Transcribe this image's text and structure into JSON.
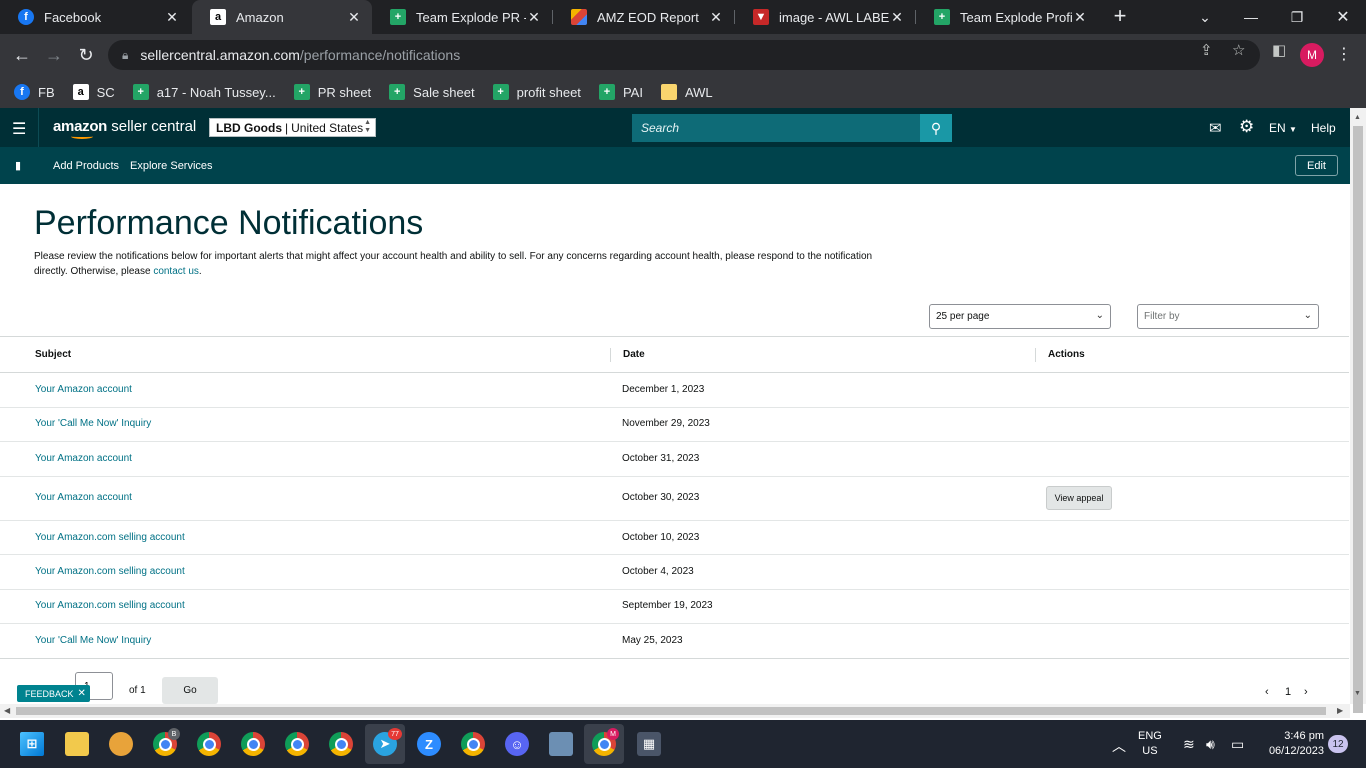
{
  "browser": {
    "tabs": [
      {
        "title": "Facebook",
        "icon": "facebook-icon"
      },
      {
        "title": "Amazon",
        "icon": "amazon-icon",
        "active": true
      },
      {
        "title": "Team Explode PR - Go",
        "icon": "sheets-icon"
      },
      {
        "title": "AMZ EOD Report",
        "icon": "eod-report-icon"
      },
      {
        "title": "image - AWL LABEL",
        "icon": "awl-icon"
      },
      {
        "title": "Team Explode Profit S",
        "icon": "sheets-icon"
      }
    ],
    "url_host": "sellercentral.amazon.com",
    "url_path": "/performance/notifications",
    "profile_initial": "M",
    "bookmarks": [
      {
        "label": "FB",
        "icon": "facebook-icon"
      },
      {
        "label": "SC",
        "icon": "amazon-icon"
      },
      {
        "label": "a17 - Noah Tussey...",
        "icon": "sheets-icon"
      },
      {
        "label": "PR sheet",
        "icon": "sheets-icon"
      },
      {
        "label": "Sale sheet",
        "icon": "sheets-icon"
      },
      {
        "label": "profit sheet",
        "icon": "sheets-icon"
      },
      {
        "label": "PAI",
        "icon": "sheets-icon"
      },
      {
        "label": "AWL",
        "icon": "folder-icon"
      }
    ]
  },
  "header": {
    "logo_brand": "amazon",
    "logo_suffix": " seller central",
    "store_name": "LBD Goods",
    "store_region": "United States",
    "search_placeholder": "Search",
    "language": "EN",
    "help": "Help",
    "nav_links": [
      "Add Products",
      "Explore Services"
    ],
    "edit": "Edit"
  },
  "page": {
    "title": "Performance Notifications",
    "intro": "Please review the notifications below for important alerts that might affect your account health and ability to sell. For any concerns regarding account health, please respond to the notification directly. Otherwise, please ",
    "contact_link": "contact us",
    "intro_end": ".",
    "per_page": "25 per page",
    "filter_placeholder": "Filter by",
    "columns": {
      "subject": "Subject",
      "date": "Date",
      "actions": "Actions"
    },
    "rows": [
      {
        "subject": "Your Amazon account",
        "date": "December 1, 2023",
        "action": ""
      },
      {
        "subject": "Your 'Call Me Now' Inquiry",
        "date": "November 29, 2023",
        "action": ""
      },
      {
        "subject": "Your Amazon account",
        "date": "October 31, 2023",
        "action": ""
      },
      {
        "subject": "Your Amazon account",
        "date": "October 30, 2023",
        "action": "View appeal"
      },
      {
        "subject": "Your Amazon.com selling account",
        "date": "October 10, 2023",
        "action": ""
      },
      {
        "subject": "Your Amazon.com selling account",
        "date": "October 4, 2023",
        "action": ""
      },
      {
        "subject": "Your Amazon.com selling account",
        "date": "September 19, 2023",
        "action": ""
      },
      {
        "subject": "Your 'Call Me Now' Inquiry",
        "date": "May 25, 2023",
        "action": ""
      }
    ],
    "pager_value": "1",
    "pager_of": "of 1",
    "go": "Go",
    "feedback": "FEEDBACK",
    "current_page": "1"
  },
  "taskbar": {
    "badges": {
      "chrome_b": "B",
      "telegram": "77",
      "chrome_m": "M"
    },
    "language": "ENG",
    "region": "US",
    "time": "3:46 pm",
    "date": "06/12/2023",
    "notifications": "12"
  },
  "colors": {
    "header_bg": "#002f36",
    "nav_bg": "#00434c",
    "link": "#007185",
    "search_bg": "#0e6b77"
  }
}
